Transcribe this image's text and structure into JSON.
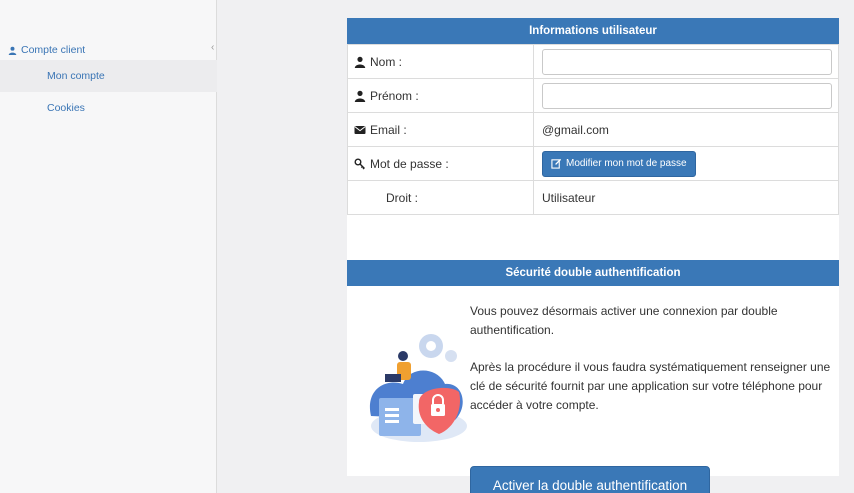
{
  "sidebar": {
    "section": "Compte client",
    "items": [
      {
        "label": "Mon compte",
        "active": true
      },
      {
        "label": "Cookies",
        "active": false
      }
    ]
  },
  "user_info": {
    "title": "Informations utilisateur",
    "rows": {
      "nom": {
        "label": "Nom :",
        "value": ""
      },
      "prenom": {
        "label": "Prénom :",
        "value": ""
      },
      "email": {
        "label": "Email :",
        "value": "@gmail.com"
      },
      "password": {
        "label": "Mot de passe :",
        "button": "Modifier mon mot de passe"
      },
      "droit": {
        "label": "Droit :",
        "value": "Utilisateur"
      }
    }
  },
  "twofa": {
    "title": "Sécurité double authentification",
    "paragraph1": "Vous pouvez désormais activer une connexion par double authentification.",
    "paragraph2": "Après la procédure il vous faudra systématiquement renseigner une clé de sécurité fournit par une application sur votre téléphone pour accéder à votre compte.",
    "button": "Activer la double authentification"
  },
  "colors": {
    "accent": "#3a78b7",
    "link": "#3a75b5",
    "lock": "#e05252"
  }
}
